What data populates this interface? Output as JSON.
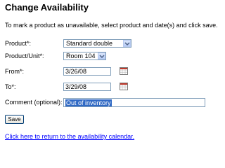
{
  "page": {
    "title": "Change Availability",
    "instructions": "To mark a product as unavailable, select product and date(s) and click save."
  },
  "form": {
    "product_label": "Product*:",
    "product_value": "Standard double",
    "unit_label": "Product/Unit*:",
    "unit_value": "Room 104",
    "from_label": "From*:",
    "from_value": "3/26/08",
    "to_label": "To*:",
    "to_value": "3/29/08",
    "comment_label": "Comment (optional):",
    "comment_value": "Out of inventory",
    "save_label": "Save"
  },
  "footer": {
    "return_link": "Click here to return to the availability calendar."
  },
  "icons": {
    "dropdown": "chevron-down-icon",
    "calendar": "calendar-icon"
  },
  "colors": {
    "link": "#0000ff",
    "selection": "#316ac5",
    "input_border": "#7f9db9"
  }
}
